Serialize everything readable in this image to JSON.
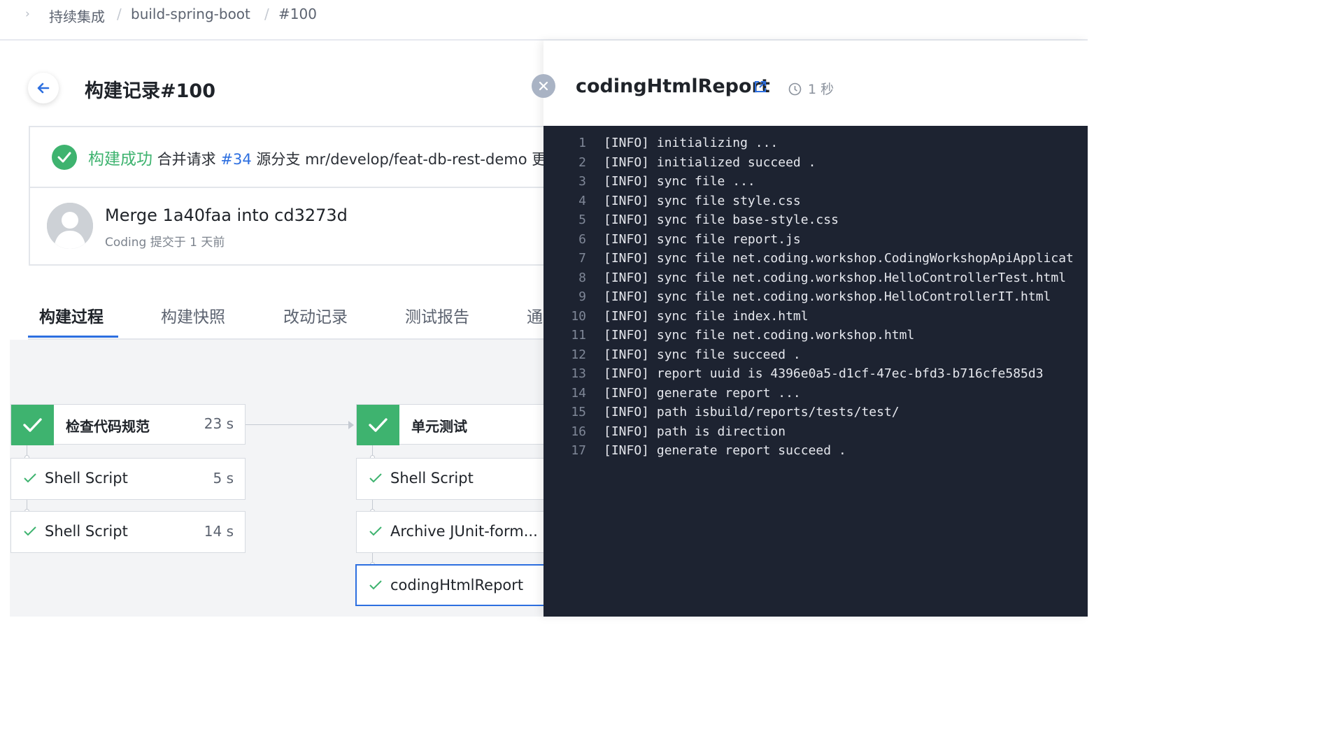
{
  "breadcrumb": {
    "items": [
      "持续集成",
      "build-spring-boot",
      "#100"
    ],
    "separator": "/"
  },
  "header": {
    "title": "构建记录#100"
  },
  "status": {
    "state": "构建成功",
    "merge_label": "合并请求",
    "merge_id": "#34",
    "branch_label": "源分支",
    "branch": "mr/develop/feat-db-rest-demo",
    "overflow": "更",
    "commit_message": "Merge 1a40faa into cd3273d",
    "commit_meta": "Coding 提交于 1 天前"
  },
  "tabs": [
    "构建过程",
    "构建快照",
    "改动记录",
    "测试报告",
    "通"
  ],
  "pipeline": {
    "stages": [
      {
        "name": "检查代码规范",
        "duration": "23 s",
        "steps": [
          {
            "name": "Shell Script",
            "duration": "5 s"
          },
          {
            "name": "Shell Script",
            "duration": "14 s"
          }
        ]
      },
      {
        "name": "单元测试",
        "duration": "",
        "steps": [
          {
            "name": "Shell Script",
            "duration": ""
          },
          {
            "name": "Archive JUnit-form...",
            "duration": ""
          },
          {
            "name": "codingHtmlReport",
            "duration": ""
          }
        ]
      }
    ]
  },
  "drawer": {
    "title": "codingHtmlReport",
    "duration": "1 秒",
    "log": [
      "[INFO] initializing ...",
      "[INFO] initialized succeed .",
      "[INFO] sync file ...",
      "[INFO] sync file  style.css",
      "[INFO] sync file  base-style.css",
      "[INFO] sync file  report.js",
      "[INFO] sync file  net.coding.workshop.CodingWorkshopApiApplicat",
      "[INFO] sync file  net.coding.workshop.HelloControllerTest.html",
      "[INFO] sync file  net.coding.workshop.HelloControllerIT.html",
      "[INFO] sync file  index.html",
      "[INFO] sync file  net.coding.workshop.html",
      "[INFO] sync file succeed .",
      "[INFO] report uuid is 4396e0a5-d1cf-47ec-bfd3-b716cfe585d3",
      "[INFO] generate report ...",
      "[INFO] path isbuild/reports/tests/test/",
      "[INFO] path is direction",
      "[INFO] generate report succeed ."
    ]
  },
  "colors": {
    "accent": "#2d6fe0",
    "success": "#3eb36f",
    "console_bg": "#1d2331"
  },
  "icons": [
    "chevron-right-icon",
    "arrow-left-icon",
    "check-circle-icon",
    "avatar-icon",
    "check-icon",
    "close-icon",
    "external-link-icon",
    "clock-icon"
  ]
}
